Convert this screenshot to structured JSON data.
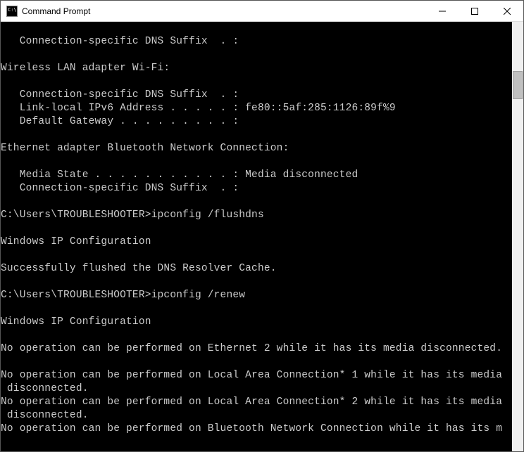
{
  "titlebar": {
    "title": "Command Prompt"
  },
  "terminal": {
    "lines": [
      "   Connection-specific DNS Suffix  . :",
      "",
      "Wireless LAN adapter Wi-Fi:",
      "",
      "   Connection-specific DNS Suffix  . :",
      "   Link-local IPv6 Address . . . . . : fe80::5af:285:1126:89f%9",
      "   Default Gateway . . . . . . . . . :",
      "",
      "Ethernet adapter Bluetooth Network Connection:",
      "",
      "   Media State . . . . . . . . . . . : Media disconnected",
      "   Connection-specific DNS Suffix  . :",
      "",
      "C:\\Users\\TROUBLESHOOTER>ipconfig /flushdns",
      "",
      "Windows IP Configuration",
      "",
      "Successfully flushed the DNS Resolver Cache.",
      "",
      "C:\\Users\\TROUBLESHOOTER>ipconfig /renew",
      "",
      "Windows IP Configuration",
      "",
      "No operation can be performed on Ethernet 2 while it has its media disconnected.",
      "",
      "No operation can be performed on Local Area Connection* 1 while it has its media",
      " disconnected.",
      "No operation can be performed on Local Area Connection* 2 while it has its media",
      " disconnected.",
      "No operation can be performed on Bluetooth Network Connection while it has its m"
    ]
  }
}
